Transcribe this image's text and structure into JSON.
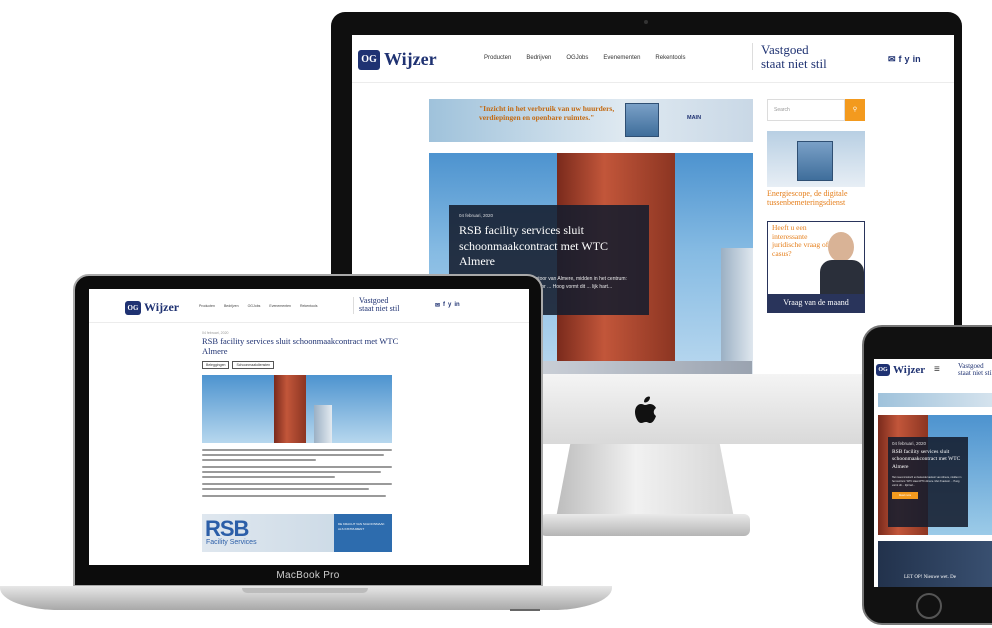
{
  "site": {
    "logo_mark": "OG",
    "logo_word": "Wijzer",
    "tagline_line1": "Vastgoed",
    "tagline_line2": "staat niet stil",
    "nav": [
      "Producten",
      "Bedrijven",
      "OGJobs",
      "Evenementen",
      "Rekentools"
    ],
    "social": [
      "✉",
      "f",
      "y",
      "in"
    ]
  },
  "banner": {
    "text": "\"Inzicht in het verbruik van uw huurders, verdiepingen en openbare ruimtes.\"",
    "badge": "MAIN"
  },
  "article": {
    "date": "04 februari, 2020",
    "title": "RSB facility services sluit schoonmaakcontract met WTC Almere",
    "excerpt": "Het meest iconisch en bekende kantoor van Almere, midden in het centrum: WTC staat WTC Almere. Met 3 kantoor ... Hoog vormt dit ... lijk hart..."
  },
  "sidebar": {
    "search_placeholder": "Search",
    "ad1_title": "Energiescope, de digitale tussenbemeteringsdienst",
    "ad2_question": "Heeft u een interessante juridische vraag of casus?",
    "ad2_footer": "Vraag van de maand"
  },
  "laptop": {
    "label": "MacBook Pro",
    "tags": [
      "Beleggingen",
      "Schoonmaakdiensten"
    ],
    "rsb_name": "RSB",
    "rsb_sub": "Facility Services",
    "rsb_side": "DE KRACHT VAN SCHOONMAAK ALS INSTRUMENT"
  },
  "phone": {
    "readmore": "Read more",
    "second_title": "LET OP! Nieuwe wet. De"
  }
}
